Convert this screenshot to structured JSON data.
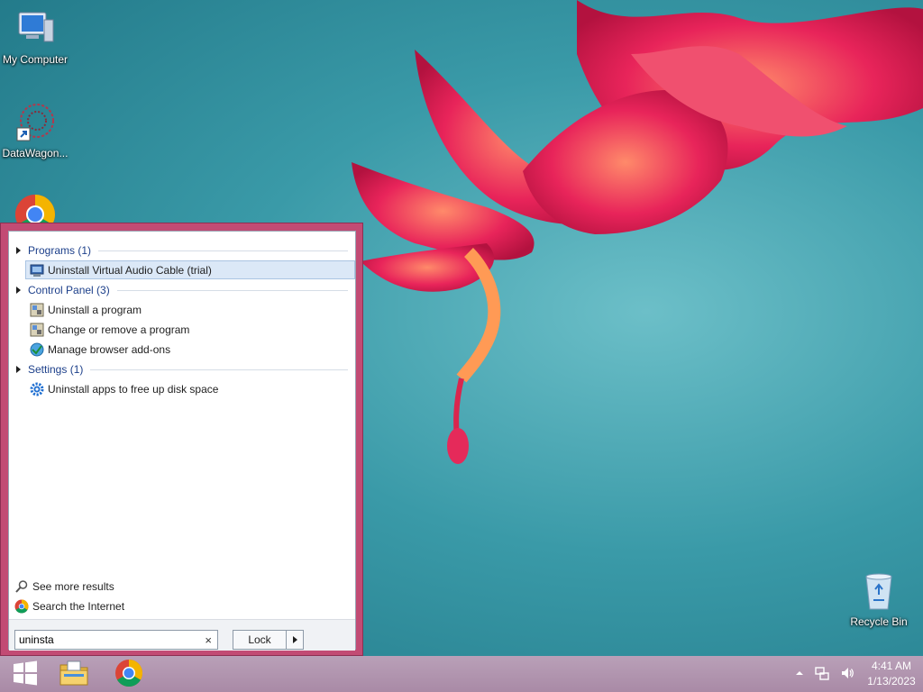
{
  "desktop": {
    "icons": [
      {
        "label": "My Computer",
        "icon": "computer-icon"
      },
      {
        "label": "DataWagon...",
        "icon": "datawagon-icon"
      },
      {
        "label": "",
        "icon": "chrome-icon"
      },
      {
        "label": "Recycle Bin",
        "icon": "recycle-bin-icon"
      }
    ]
  },
  "start_menu": {
    "categories": [
      {
        "label": "Programs (1)",
        "items": [
          {
            "label": "Uninstall Virtual Audio Cable (trial)",
            "icon": "installer-icon",
            "selected": true
          }
        ]
      },
      {
        "label": "Control Panel (3)",
        "items": [
          {
            "label": "Uninstall a program",
            "icon": "programs-features-icon"
          },
          {
            "label": "Change or remove a program",
            "icon": "programs-features-icon"
          },
          {
            "label": "Manage browser add-ons",
            "icon": "internet-options-icon"
          }
        ]
      },
      {
        "label": "Settings (1)",
        "items": [
          {
            "label": "Uninstall apps to free up disk space",
            "icon": "gear-icon"
          }
        ]
      }
    ],
    "see_more": "See more results",
    "search_internet": "Search the Internet",
    "search": {
      "value": "uninsta",
      "clear_glyph": "×"
    },
    "lock_label": "Lock"
  },
  "taskbar": {
    "pinned": [
      {
        "name": "start-button",
        "icon": "windows-logo-icon"
      },
      {
        "name": "file-explorer-button",
        "icon": "folder-icon"
      },
      {
        "name": "chrome-button",
        "icon": "chrome-icon"
      }
    ],
    "clock": {
      "time": "4:41 AM",
      "date": "1/13/2023"
    }
  },
  "colors": {
    "start_menu_frame": "#c24b74",
    "taskbar": "#b097ae",
    "link_blue": "#1c3f8a",
    "selection": "#dbe8f7"
  }
}
